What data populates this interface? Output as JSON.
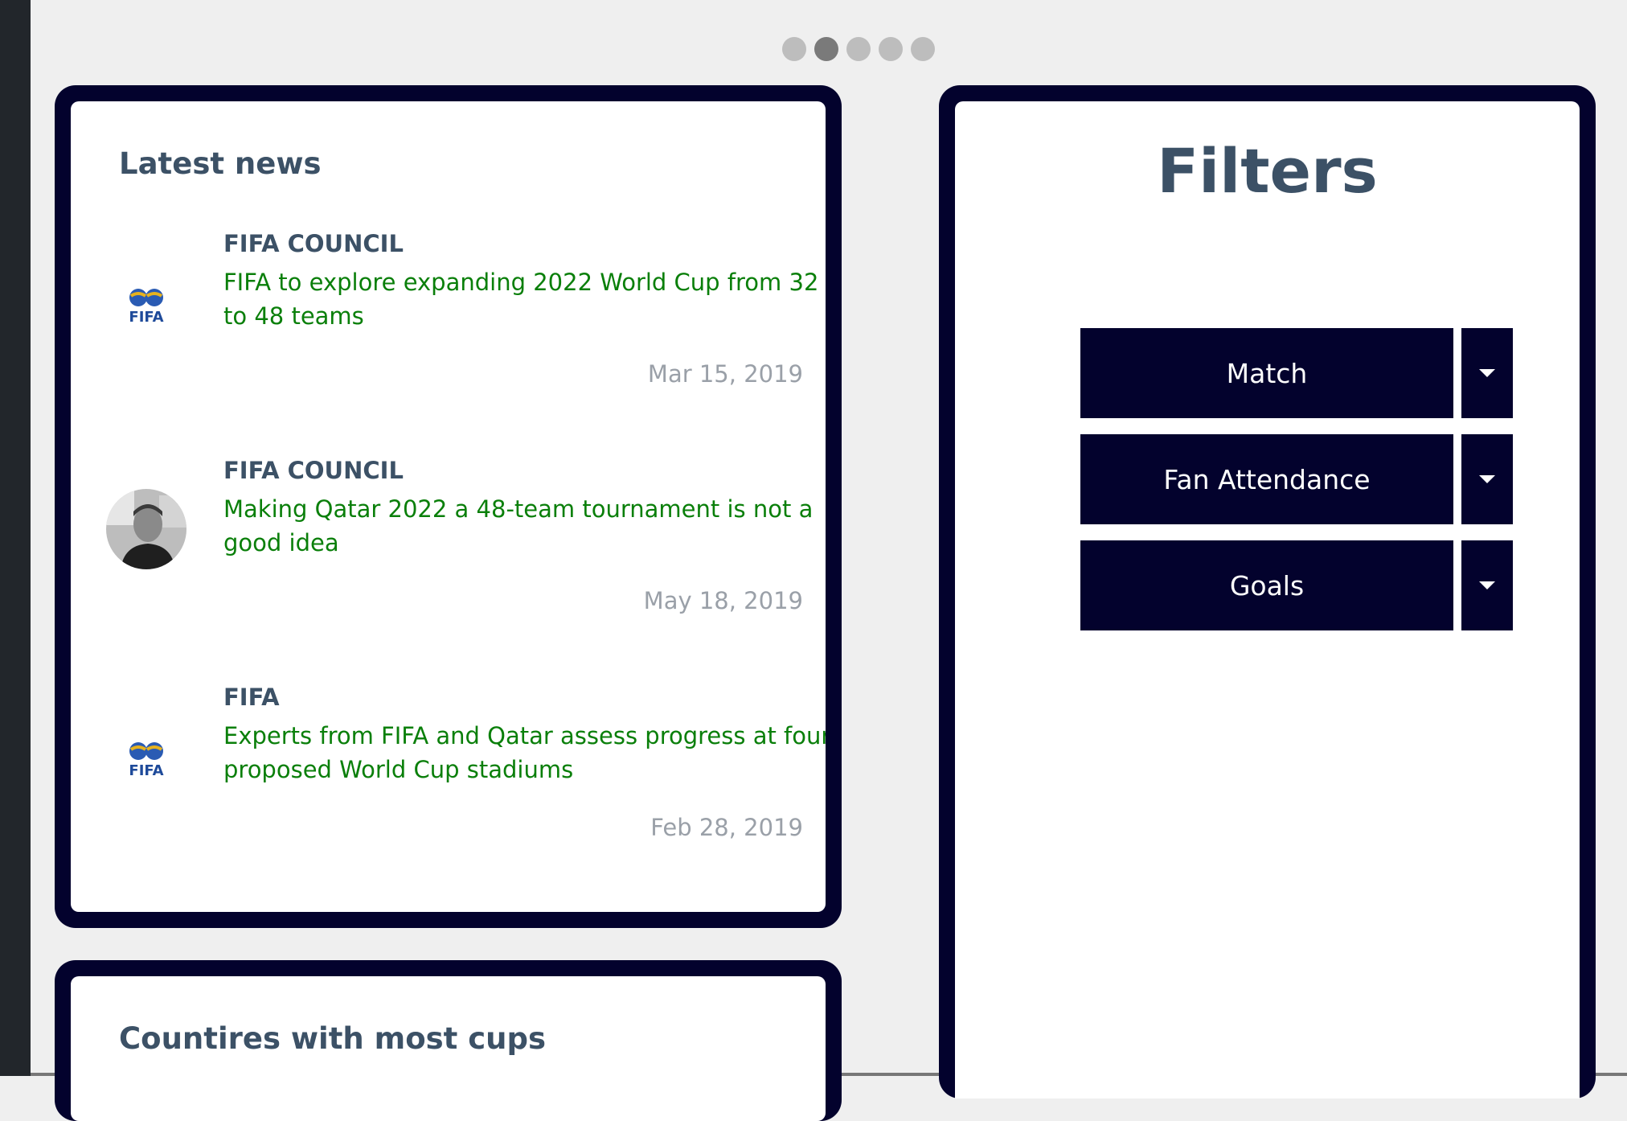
{
  "carousel": {
    "slide_count": 5,
    "active_index": 1
  },
  "news": {
    "title": "Latest news",
    "items": [
      {
        "source": "FIFA COUNCIL",
        "headline": "FIFA to explore expanding 2022 World Cup from 32 to 48 teams",
        "date": "Mar 15, 2019",
        "avatar": "fifa-logo",
        "logo_text": "FIFA"
      },
      {
        "source": "FIFA COUNCIL",
        "headline": "Making Qatar 2022 a 48-team tournament is not a good idea",
        "date": "May 18, 2019",
        "avatar": "person-photo"
      },
      {
        "source": "FIFA",
        "headline": "Experts from FIFA and Qatar assess progress at four proposed World Cup stadiums",
        "date": "Feb 28, 2019",
        "avatar": "fifa-logo",
        "logo_text": "FIFA"
      }
    ]
  },
  "cups": {
    "title": "Countires with most cups"
  },
  "filters": {
    "title": "Filters",
    "items": [
      {
        "label": "Match",
        "icon": "caret-down-icon"
      },
      {
        "label": "Fan Attendance",
        "icon": "caret-down-icon"
      },
      {
        "label": "Goals",
        "icon": "caret-down-icon"
      }
    ]
  },
  "colors": {
    "card_border": "#03022d",
    "heading": "#3c5166",
    "headline_link": "#0a7f0a",
    "date": "#9aa0a8",
    "page_bg": "#efefef"
  }
}
